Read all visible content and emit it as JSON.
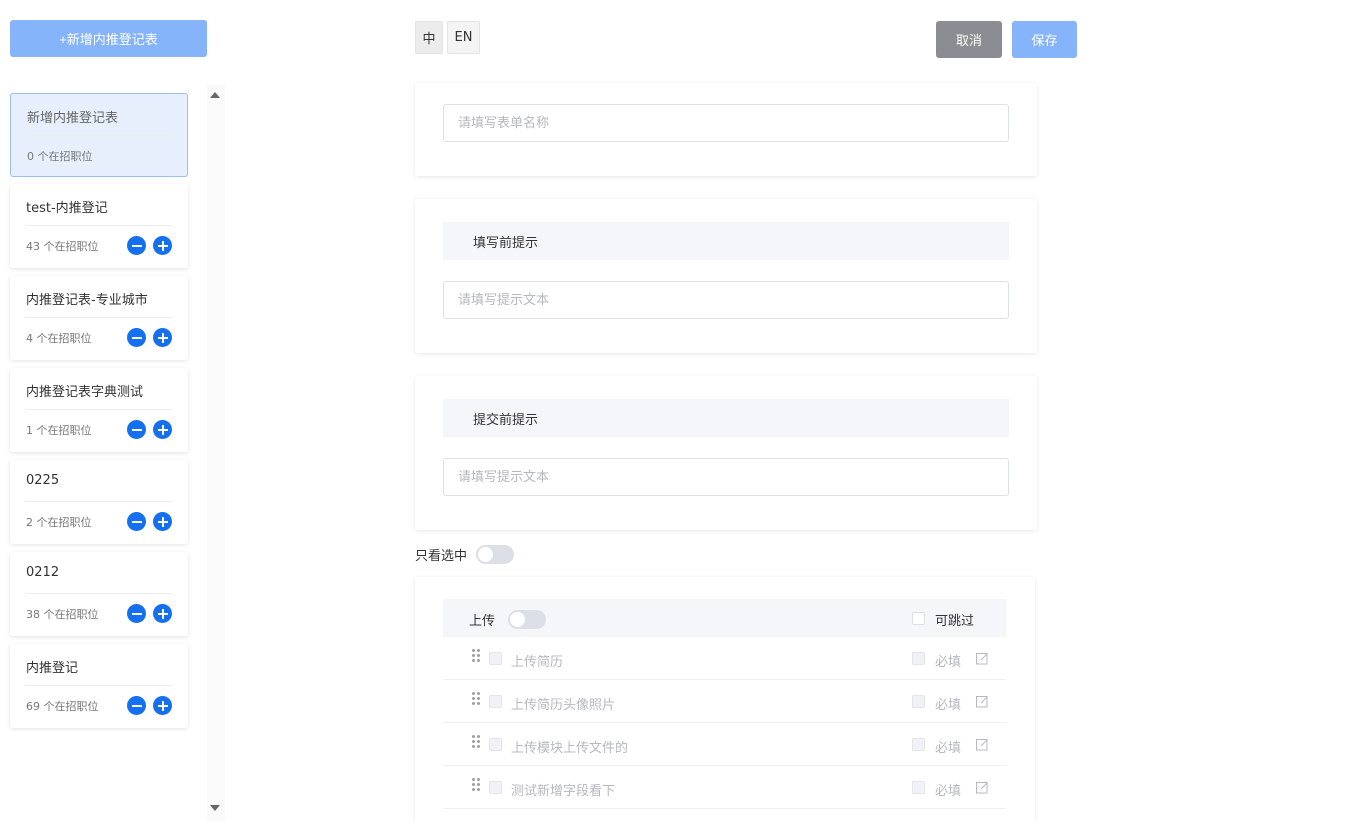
{
  "sidebar": {
    "add_button": "+新增内推登记表",
    "cards": [
      {
        "title": "新增内推登记表",
        "sub": "0 个在招职位",
        "active": true,
        "actions": false
      },
      {
        "title": "test-内推登记",
        "sub": "43 个在招职位",
        "active": false,
        "actions": true
      },
      {
        "title": "内推登记表-专业城市",
        "sub": "4 个在招职位",
        "active": false,
        "actions": true
      },
      {
        "title": "内推登记表字典测试",
        "sub": "1 个在招职位",
        "active": false,
        "actions": true
      },
      {
        "title": "0225",
        "sub": "2 个在招职位",
        "active": false,
        "actions": true
      },
      {
        "title": "0212",
        "sub": "38 个在招职位",
        "active": false,
        "actions": true
      },
      {
        "title": "内推登记",
        "sub": "69 个在招职位",
        "active": false,
        "actions": true
      }
    ]
  },
  "lang": {
    "zh": "中",
    "en": "EN"
  },
  "header": {
    "cancel": "取消",
    "save": "保存"
  },
  "form": {
    "name_placeholder": "请填写表单名称",
    "before_fill": {
      "title": "填写前提示",
      "placeholder": "请填写提示文本"
    },
    "before_submit": {
      "title": "提交前提示",
      "placeholder": "请填写提示文本"
    },
    "only_selected": "只看选中",
    "upload": {
      "title": "上传",
      "skippable": "可跳过",
      "fields": [
        {
          "label": "上传简历",
          "required": "必填"
        },
        {
          "label": "上传简历头像照片",
          "required": "必填"
        },
        {
          "label": "上传模块上传文件的",
          "required": "必填"
        },
        {
          "label": "测试新增字段看下",
          "required": "必填"
        }
      ]
    }
  },
  "colors": {
    "primary": "#1570ef",
    "primary_light": "#86b4fb",
    "cancel": "#8b8d92"
  }
}
